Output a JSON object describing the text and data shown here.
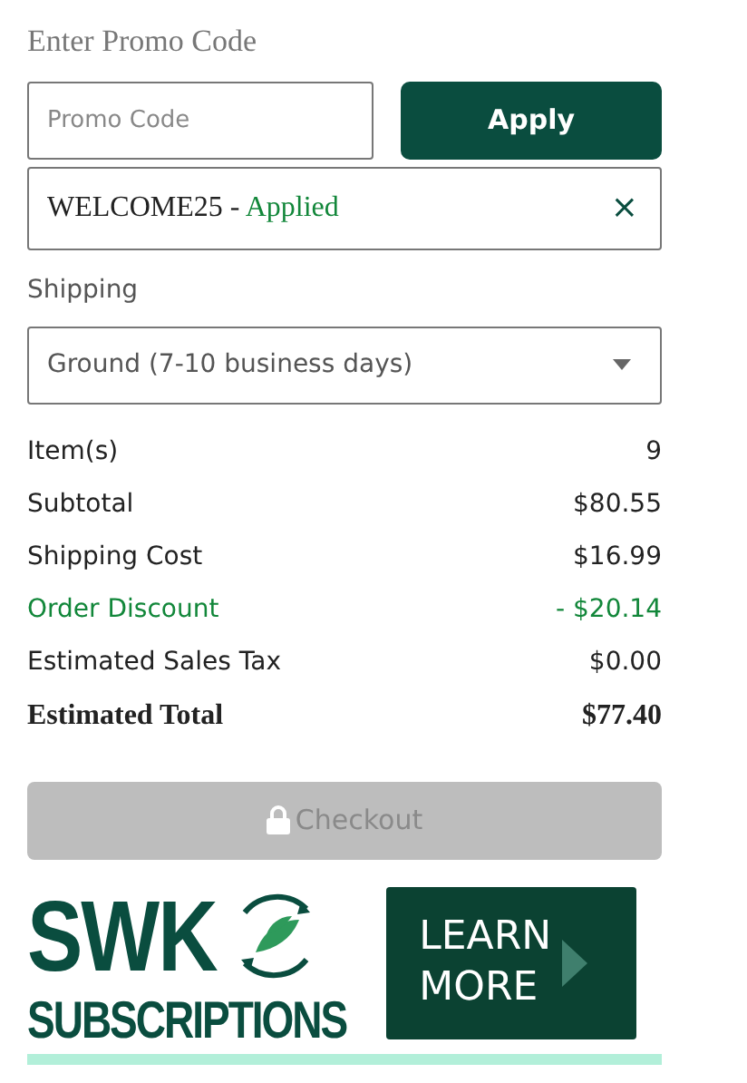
{
  "promo": {
    "heading": "Enter Promo Code",
    "placeholder": "Promo Code",
    "button": "Apply",
    "applied_code": "WELCOME25",
    "applied_separator": "-",
    "applied_status": "Applied",
    "remove": "×"
  },
  "shipping": {
    "label": "Shipping",
    "selected_option": "Ground (7-10 business days)"
  },
  "summary": [
    {
      "label": "Item(s)",
      "value": "9",
      "kind": "normal"
    },
    {
      "label": "Subtotal",
      "value": "$80.55",
      "kind": "normal"
    },
    {
      "label": "Shipping Cost",
      "value": "$16.99",
      "kind": "normal"
    },
    {
      "label": "Order Discount",
      "value": "- $20.14",
      "kind": "discount"
    },
    {
      "label": "Estimated Sales Tax",
      "value": "$0.00",
      "kind": "normal"
    },
    {
      "label": "Estimated Total",
      "value": "$77.40",
      "kind": "total"
    }
  ],
  "checkout": {
    "label": "Checkout",
    "disabled": true
  },
  "banner": {
    "logo_top": "SWK",
    "logo_bottom": "SUBSCRIPTIONS",
    "cta_line1": "LEARN",
    "cta_line2": "MORE"
  }
}
